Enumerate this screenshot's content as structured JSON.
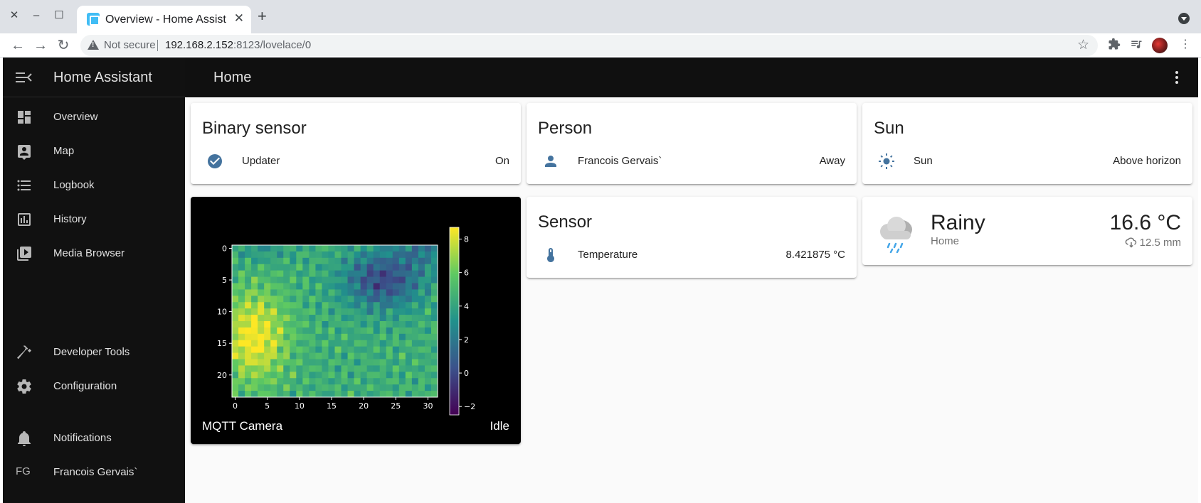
{
  "browser": {
    "tab_title": "Overview - Home Assistant",
    "tab_close": "✕",
    "new_tab": "+",
    "security_label": "Not secure",
    "url_host": "192.168.2.152",
    "url_rest": ":8123/lovelace/0"
  },
  "sidebar": {
    "title": "Home Assistant",
    "items": [
      {
        "label": "Overview",
        "icon": "view-dashboard-icon"
      },
      {
        "label": "Map",
        "icon": "account-box-icon"
      },
      {
        "label": "Logbook",
        "icon": "format-list-bulleted-icon"
      },
      {
        "label": "History",
        "icon": "chart-box-icon"
      },
      {
        "label": "Media Browser",
        "icon": "play-box-multiple-icon"
      }
    ],
    "bottom_items": [
      {
        "label": "Developer Tools",
        "icon": "hammer-icon"
      },
      {
        "label": "Configuration",
        "icon": "cog-icon"
      },
      {
        "label": "Notifications",
        "icon": "bell-icon"
      }
    ],
    "user": {
      "initials": "FG",
      "name": "Francois Gervais`"
    }
  },
  "toolbar": {
    "title": "Home"
  },
  "cards": {
    "binary_sensor": {
      "title": "Binary sensor",
      "entity": "Updater",
      "state": "On",
      "icon": "check-circle-icon"
    },
    "person": {
      "title": "Person",
      "entity": "Francois Gervais`",
      "state": "Away",
      "icon": "account-icon"
    },
    "sun": {
      "title": "Sun",
      "entity": "Sun",
      "state": "Above horizon",
      "icon": "white-balance-sunny-icon"
    },
    "sensor": {
      "title": "Sensor",
      "entity": "Temperature",
      "state": "8.421875 °C",
      "icon": "thermometer-icon"
    },
    "weather": {
      "condition": "Rainy",
      "location": "Home",
      "temperature": "16.6 °C",
      "precipitation": "12.5 mm",
      "icon": "weather-rainy-icon"
    },
    "camera": {
      "name": "MQTT Camera",
      "state": "Idle"
    }
  },
  "chart_data": {
    "type": "heatmap",
    "title": "",
    "xlabel": "",
    "ylabel": "",
    "x_ticks": [
      "0",
      "5",
      "10",
      "15",
      "20",
      "25",
      "30"
    ],
    "y_ticks": [
      "0",
      "5",
      "10",
      "15",
      "20"
    ],
    "colorbar_ticks": [
      "8",
      "6",
      "4",
      "2",
      "0",
      "−2"
    ],
    "colormap": "viridis",
    "value_range": [
      -2.5,
      8.7
    ],
    "grid_size": [
      32,
      24
    ]
  }
}
